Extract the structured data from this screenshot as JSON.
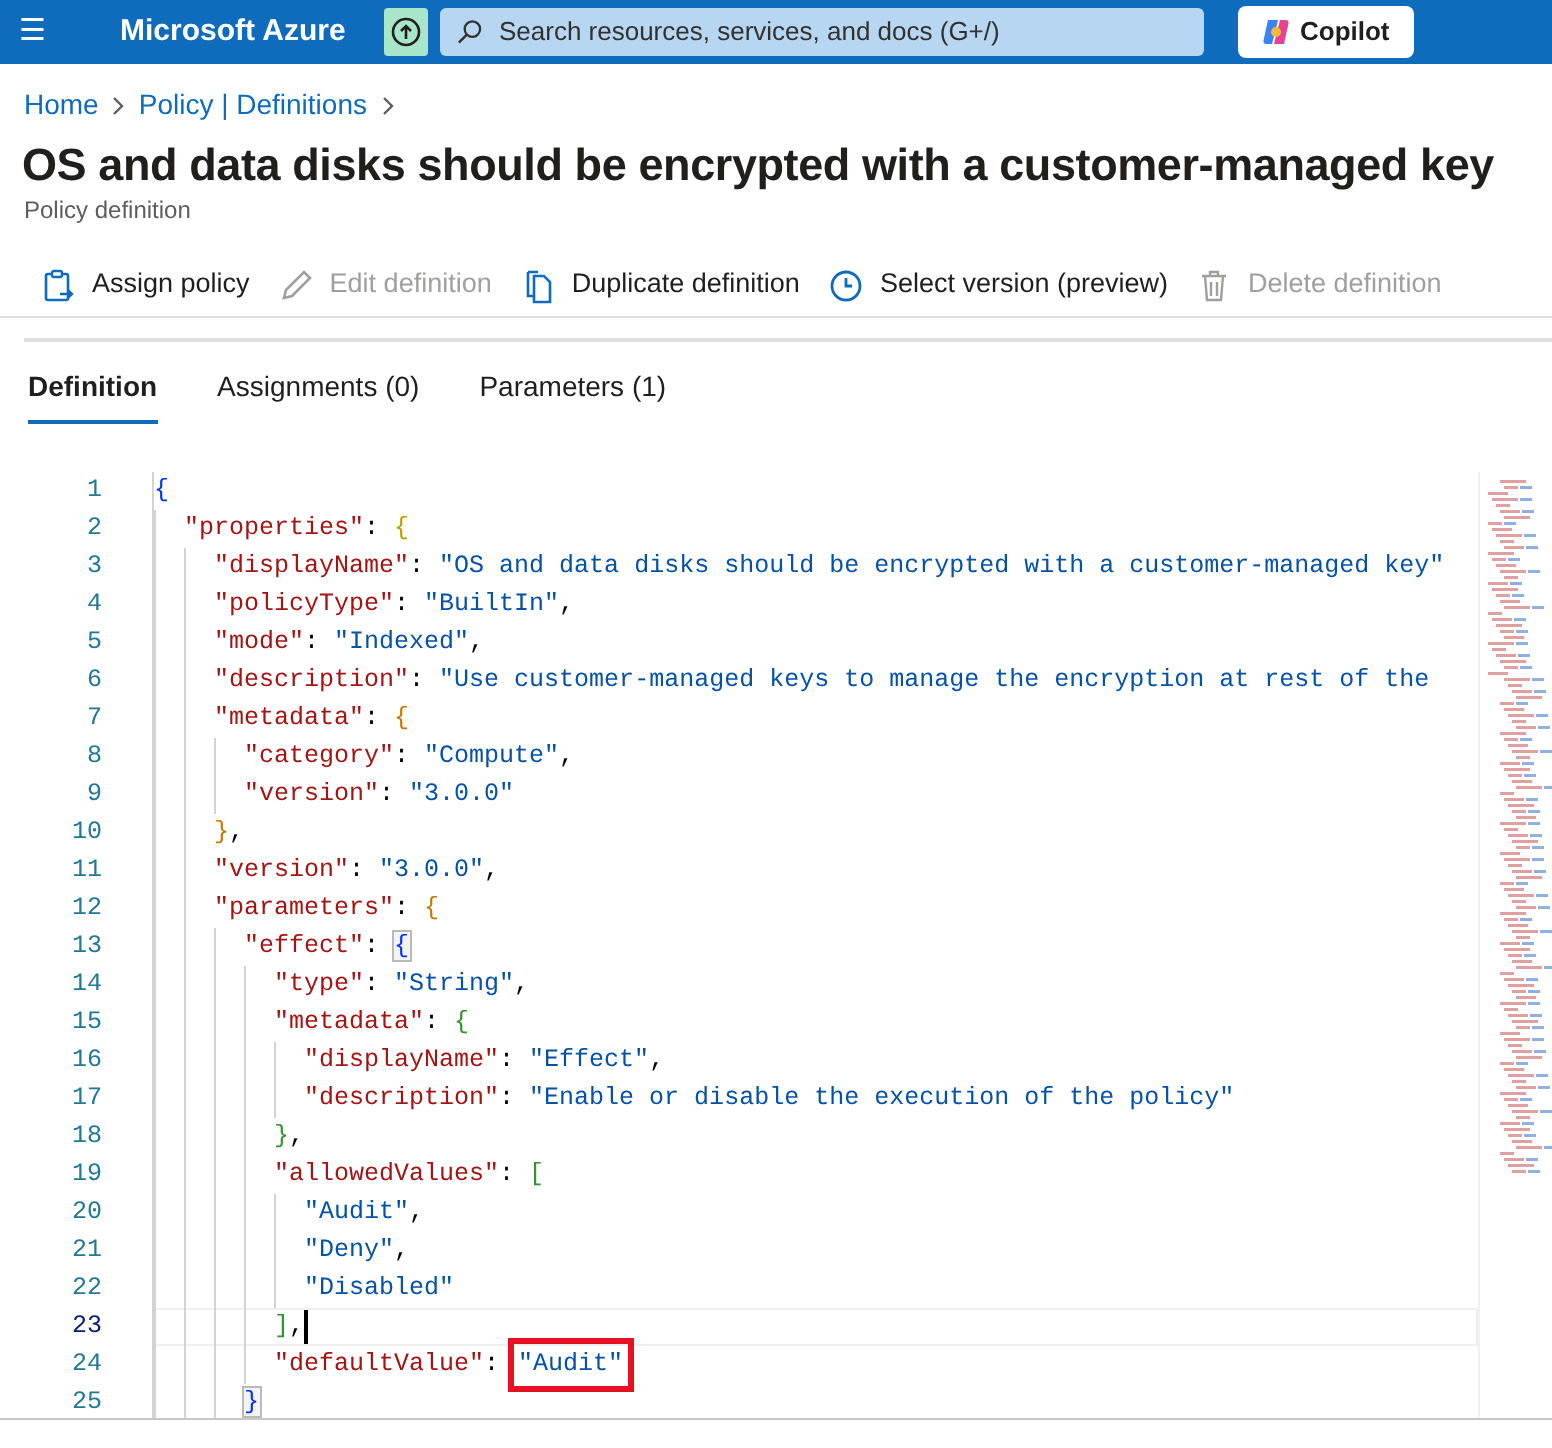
{
  "topbar": {
    "menu": "☰",
    "brand": "Microsoft Azure",
    "search": {
      "placeholder": "Search resources, services, and docs (G+/)"
    },
    "copilot": "Copilot"
  },
  "breadcrumb": [
    "Home",
    "Policy | Definitions"
  ],
  "title": "OS and data disks should be encrypted with a customer-managed key",
  "subtitle": "Policy definition",
  "toolbar": [
    {
      "kind": "assign",
      "label": "Assign policy",
      "disabled": false
    },
    {
      "kind": "edit",
      "label": "Edit definition",
      "disabled": true
    },
    {
      "kind": "duplicate",
      "label": "Duplicate definition",
      "disabled": false
    },
    {
      "kind": "version",
      "label": "Select version (preview)",
      "disabled": false
    },
    {
      "kind": "delete",
      "label": "Delete definition",
      "disabled": true
    }
  ],
  "tabs": [
    {
      "label": "Definition",
      "selected": true
    },
    {
      "label": "Assignments (0)",
      "selected": false
    },
    {
      "label": "Parameters (1)",
      "selected": false
    }
  ],
  "editor": {
    "lines": [
      {
        "number": "1",
        "tokens": [
          {
            "kind": "bracket",
            "text": "{",
            "color": "#0431fa"
          }
        ],
        "children": [
          {
            "number": "2",
            "tokens": [
              {
                "kind": "key",
                "text": "\"properties\""
              },
              {
                "kind": "punct",
                "text": ": "
              },
              {
                "kind": "bracket",
                "text": "{",
                "color": "#b5a200"
              }
            ],
            "children": [
              {
                "number": "3",
                "tokens": [
                  {
                    "kind": "key",
                    "text": "\"displayName\""
                  },
                  {
                    "kind": "punct",
                    "text": ": "
                  },
                  {
                    "kind": "string",
                    "text": "\"OS and data disks should be encrypted with a customer-managed key\""
                  }
                ]
              },
              {
                "number": "4",
                "tokens": [
                  {
                    "kind": "key",
                    "text": "\"policyType\""
                  },
                  {
                    "kind": "punct",
                    "text": ": "
                  },
                  {
                    "kind": "string",
                    "text": "\"BuiltIn\""
                  },
                  {
                    "kind": "punct",
                    "text": ","
                  }
                ]
              },
              {
                "number": "5",
                "tokens": [
                  {
                    "kind": "key",
                    "text": "\"mode\""
                  },
                  {
                    "kind": "punct",
                    "text": ": "
                  },
                  {
                    "kind": "string",
                    "text": "\"Indexed\""
                  },
                  {
                    "kind": "punct",
                    "text": ","
                  }
                ]
              },
              {
                "number": "6",
                "tokens": [
                  {
                    "kind": "key",
                    "text": "\"description\""
                  },
                  {
                    "kind": "punct",
                    "text": ": "
                  },
                  {
                    "kind": "string",
                    "text": "\"Use customer-managed keys to manage the encryption at rest of the"
                  }
                ]
              },
              {
                "number": "7",
                "tokens": [
                  {
                    "kind": "key",
                    "text": "\"metadata\""
                  },
                  {
                    "kind": "punct",
                    "text": ": "
                  },
                  {
                    "kind": "bracket",
                    "text": "{",
                    "color": "#c47a00"
                  }
                ],
                "children": [
                  {
                    "number": "8",
                    "tokens": [
                      {
                        "kind": "key",
                        "text": "\"category\""
                      },
                      {
                        "kind": "punct",
                        "text": ": "
                      },
                      {
                        "kind": "string",
                        "text": "\"Compute\""
                      },
                      {
                        "kind": "punct",
                        "text": ","
                      }
                    ]
                  },
                  {
                    "number": "9",
                    "tokens": [
                      {
                        "kind": "key",
                        "text": "\"version\""
                      },
                      {
                        "kind": "punct",
                        "text": ": "
                      },
                      {
                        "kind": "string",
                        "text": "\"3.0.0\""
                      }
                    ]
                  }
                ]
              },
              {
                "number": "10",
                "tokens": [
                  {
                    "kind": "bracket",
                    "text": "}",
                    "color": "#c47a00"
                  },
                  {
                    "kind": "punct",
                    "text": ","
                  }
                ]
              },
              {
                "number": "11",
                "tokens": [
                  {
                    "kind": "key",
                    "text": "\"version\""
                  },
                  {
                    "kind": "punct",
                    "text": ": "
                  },
                  {
                    "kind": "string",
                    "text": "\"3.0.0\""
                  },
                  {
                    "kind": "punct",
                    "text": ","
                  }
                ]
              },
              {
                "number": "12",
                "tokens": [
                  {
                    "kind": "key",
                    "text": "\"parameters\""
                  },
                  {
                    "kind": "punct",
                    "text": ": "
                  },
                  {
                    "kind": "bracket",
                    "text": "{",
                    "color": "#c47a00"
                  }
                ],
                "children": [
                  {
                    "number": "13",
                    "tokens": [
                      {
                        "kind": "key",
                        "text": "\"effect\""
                      },
                      {
                        "kind": "punct",
                        "text": ": "
                      },
                      {
                        "kind": "match",
                        "text": "{",
                        "color": "#0431fa"
                      }
                    ],
                    "children": [
                      {
                        "number": "14",
                        "tokens": [
                          {
                            "kind": "key",
                            "text": "\"type\""
                          },
                          {
                            "kind": "punct",
                            "text": ": "
                          },
                          {
                            "kind": "string",
                            "text": "\"String\""
                          },
                          {
                            "kind": "punct",
                            "text": ","
                          }
                        ]
                      },
                      {
                        "number": "15",
                        "tokens": [
                          {
                            "kind": "key",
                            "text": "\"metadata\""
                          },
                          {
                            "kind": "punct",
                            "text": ": "
                          },
                          {
                            "kind": "bracket",
                            "text": "{",
                            "color": "#319331"
                          }
                        ],
                        "children": [
                          {
                            "number": "16",
                            "tokens": [
                              {
                                "kind": "key",
                                "text": "\"displayName\""
                              },
                              {
                                "kind": "punct",
                                "text": ": "
                              },
                              {
                                "kind": "string",
                                "text": "\"Effect\""
                              },
                              {
                                "kind": "punct",
                                "text": ","
                              }
                            ]
                          },
                          {
                            "number": "17",
                            "tokens": [
                              {
                                "kind": "key",
                                "text": "\"description\""
                              },
                              {
                                "kind": "punct",
                                "text": ": "
                              },
                              {
                                "kind": "string",
                                "text": "\"Enable or disable the execution of the policy\""
                              }
                            ]
                          }
                        ]
                      },
                      {
                        "number": "18",
                        "tokens": [
                          {
                            "kind": "bracket",
                            "text": "}",
                            "color": "#319331"
                          },
                          {
                            "kind": "punct",
                            "text": ","
                          }
                        ]
                      },
                      {
                        "number": "19",
                        "tokens": [
                          {
                            "kind": "key",
                            "text": "\"allowedValues\""
                          },
                          {
                            "kind": "punct",
                            "text": ": "
                          },
                          {
                            "kind": "bracket",
                            "text": "[",
                            "color": "#319331"
                          }
                        ],
                        "children": [
                          {
                            "number": "20",
                            "tokens": [
                              {
                                "kind": "string",
                                "text": "\"Audit\""
                              },
                              {
                                "kind": "punct",
                                "text": ","
                              }
                            ]
                          },
                          {
                            "number": "21",
                            "tokens": [
                              {
                                "kind": "string",
                                "text": "\"Deny\""
                              },
                              {
                                "kind": "punct",
                                "text": ","
                              }
                            ]
                          },
                          {
                            "number": "22",
                            "tokens": [
                              {
                                "kind": "string",
                                "text": "\"Disabled\""
                              }
                            ]
                          }
                        ]
                      },
                      {
                        "number": "23",
                        "current": true,
                        "tokens": [
                          {
                            "kind": "bracket",
                            "text": "]",
                            "color": "#319331"
                          },
                          {
                            "kind": "punct",
                            "text": ","
                          }
                        ]
                      },
                      {
                        "number": "24",
                        "tokens": [
                          {
                            "kind": "key",
                            "text": "\"defaultValue\""
                          },
                          {
                            "kind": "punct",
                            "text": ": "
                          },
                          {
                            "kind": "highlight",
                            "text": "\"Audit\""
                          }
                        ]
                      }
                    ]
                  },
                  {
                    "number": "25",
                    "tokens": [
                      {
                        "kind": "match",
                        "text": "}",
                        "color": "#0431fa"
                      }
                    ]
                  }
                ]
              }
            ]
          }
        ]
      }
    ]
  }
}
